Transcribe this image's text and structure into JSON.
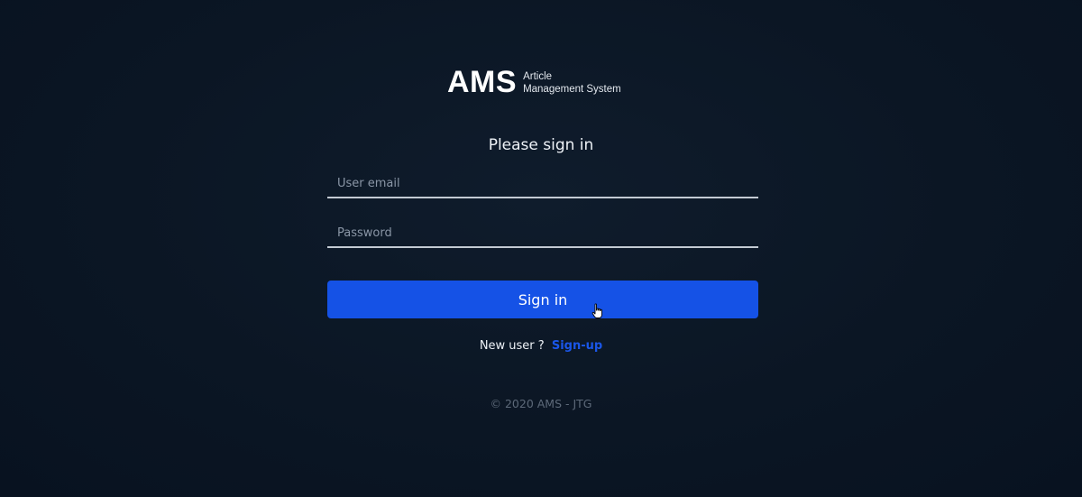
{
  "brand": {
    "name": "AMS",
    "subtitle_line1": "Article",
    "subtitle_line2": "Management System"
  },
  "form": {
    "title": "Please sign in",
    "email_placeholder": "User email",
    "email_value": "",
    "password_placeholder": "Password",
    "password_value": "",
    "submit_label": "Sign in"
  },
  "signup": {
    "prompt": "New user ?",
    "link_label": "Sign-up"
  },
  "footer": {
    "copyright": "© 2020 AMS - JTG"
  },
  "colors": {
    "background": "#0b1624",
    "accent": "#1552e6",
    "link": "#1a56e8"
  },
  "icons": {
    "cursor": "hand-pointer-icon"
  }
}
